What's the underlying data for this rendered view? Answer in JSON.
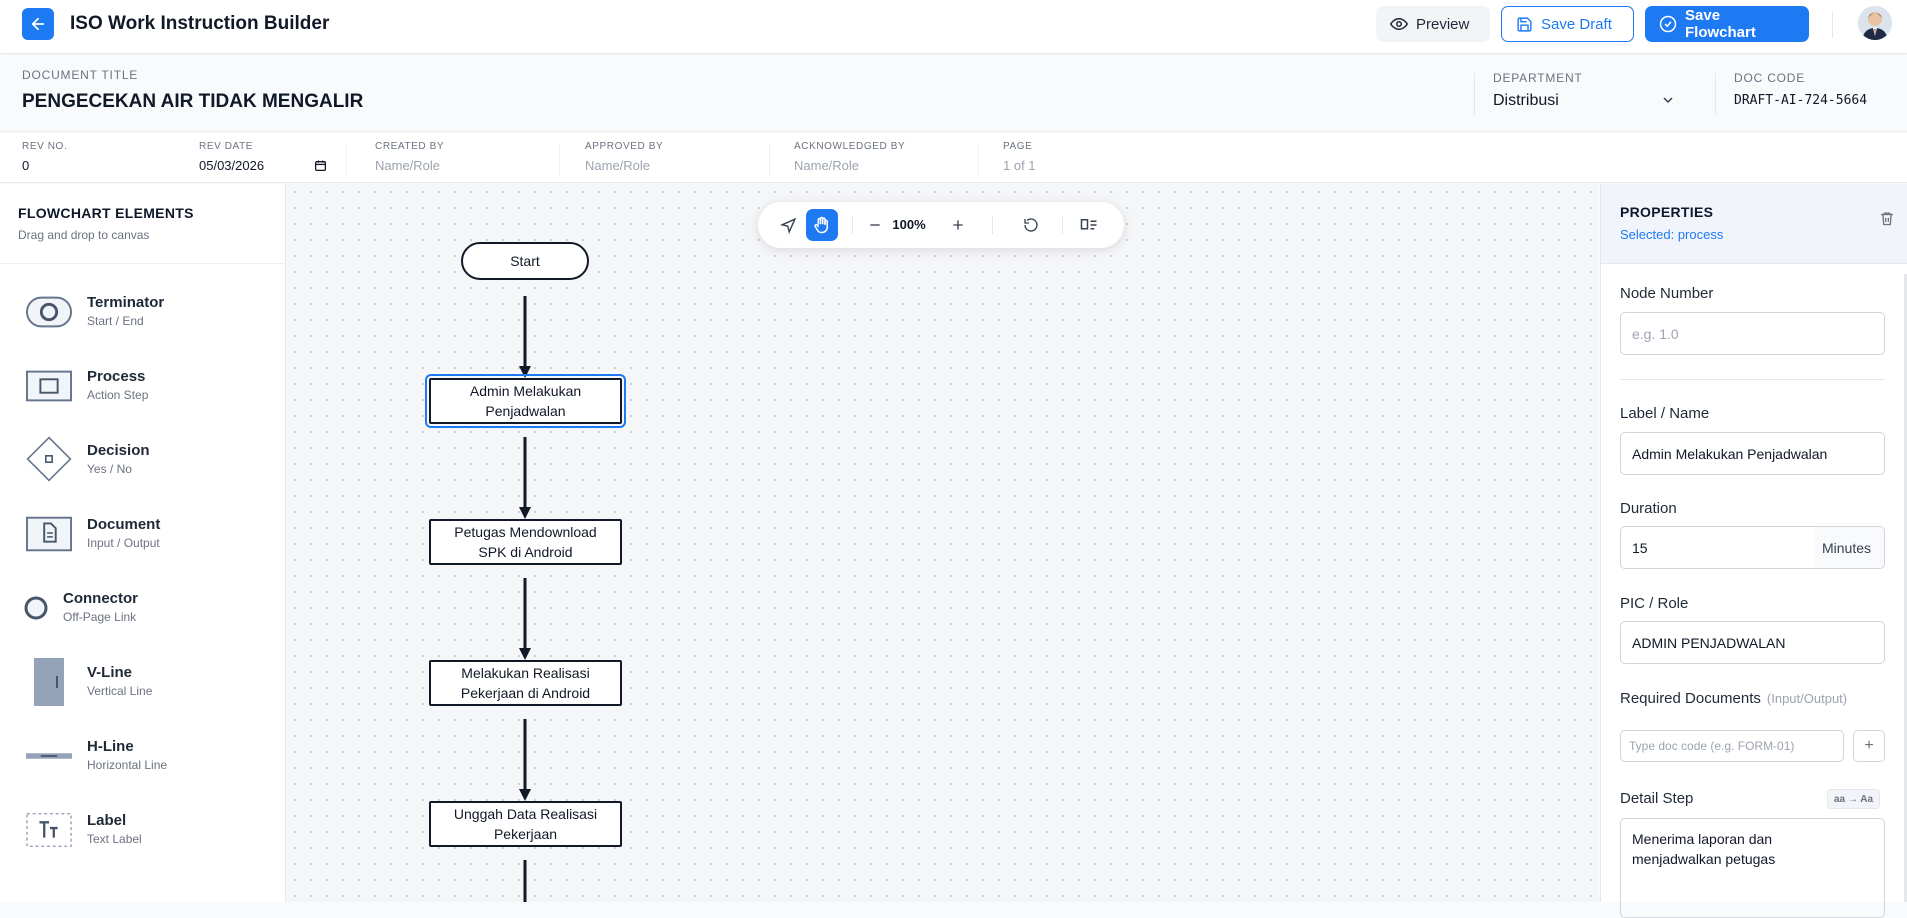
{
  "header": {
    "title": "ISO Work Instruction Builder",
    "preview_label": "Preview",
    "save_draft_label": "Save Draft",
    "save_flowchart_label": "Save Flowchart"
  },
  "document": {
    "title_caption": "DOCUMENT TITLE",
    "title": "PENGECEKAN AIR TIDAK MENGALIR",
    "department_caption": "DEPARTMENT",
    "department": "Distribusi",
    "doc_code_caption": "DOC CODE",
    "doc_code": "DRAFT-AI-724-5664"
  },
  "meta": {
    "rev_no_caption": "REV NO.",
    "rev_no": "0",
    "rev_date_caption": "REV DATE",
    "rev_date": "05/03/2026",
    "created_by_caption": "CREATED BY",
    "created_by_placeholder": "Name/Role",
    "approved_by_caption": "APPROVED BY",
    "approved_by_placeholder": "Name/Role",
    "acknowledged_by_caption": "ACKNOWLEDGED BY",
    "acknowledged_by_placeholder": "Name/Role",
    "page_caption": "PAGE",
    "page": "1 of 1"
  },
  "sidebar": {
    "title": "FLOWCHART ELEMENTS",
    "subtitle": "Drag and drop to canvas",
    "items": [
      {
        "name": "Terminator",
        "desc": "Start / End",
        "icon": "terminator-icon"
      },
      {
        "name": "Process",
        "desc": "Action Step",
        "icon": "process-icon"
      },
      {
        "name": "Decision",
        "desc": "Yes / No",
        "icon": "decision-icon"
      },
      {
        "name": "Document",
        "desc": "Input / Output",
        "icon": "document-icon"
      },
      {
        "name": "Connector",
        "desc": "Off-Page Link",
        "icon": "connector-icon"
      },
      {
        "name": "V-Line",
        "desc": "Vertical Line",
        "icon": "v-line-icon"
      },
      {
        "name": "H-Line",
        "desc": "Horizontal Line",
        "icon": "h-line-icon"
      },
      {
        "name": "Label",
        "desc": "Text Label",
        "icon": "label-icon"
      }
    ]
  },
  "toolbar": {
    "zoom": "100%",
    "active_tool": "hand"
  },
  "canvas": {
    "nodes": [
      {
        "type": "terminator",
        "label": "Start"
      },
      {
        "type": "process",
        "label": "Admin Melakukan Penjadwalan",
        "selected": true
      },
      {
        "type": "process",
        "label": "Petugas Mendownload SPK di Android"
      },
      {
        "type": "process",
        "label": "Melakukan Realisasi Pekerjaan di Android"
      },
      {
        "type": "process",
        "label": "Unggah Data Realisasi Pekerjaan"
      }
    ]
  },
  "properties": {
    "title": "PROPERTIES",
    "selected": "Selected: process",
    "node_number_label": "Node Number",
    "node_number_placeholder": "e.g. 1.0",
    "label_name_label": "Label / Name",
    "label_name_value": "Admin Melakukan Penjadwalan",
    "duration_label": "Duration",
    "duration_value": "15",
    "duration_unit": "Minutes",
    "pic_label": "PIC / Role",
    "pic_value": "ADMIN PENJADWALAN",
    "required_docs_label": "Required Documents",
    "required_docs_hint": "(Input/Output)",
    "required_docs_placeholder": "Type doc code (e.g. FORM-01)",
    "add_label": "+",
    "detail_step_label": "Detail Step",
    "case_toggle_label": "aa → Aa",
    "detail_step_value": "Menerima laporan dan\nmenjadwalkan petugas"
  },
  "colors": {
    "accent": "#1d7af3",
    "node_border": "#111827",
    "canvas_bg": "#f5f6f8"
  }
}
